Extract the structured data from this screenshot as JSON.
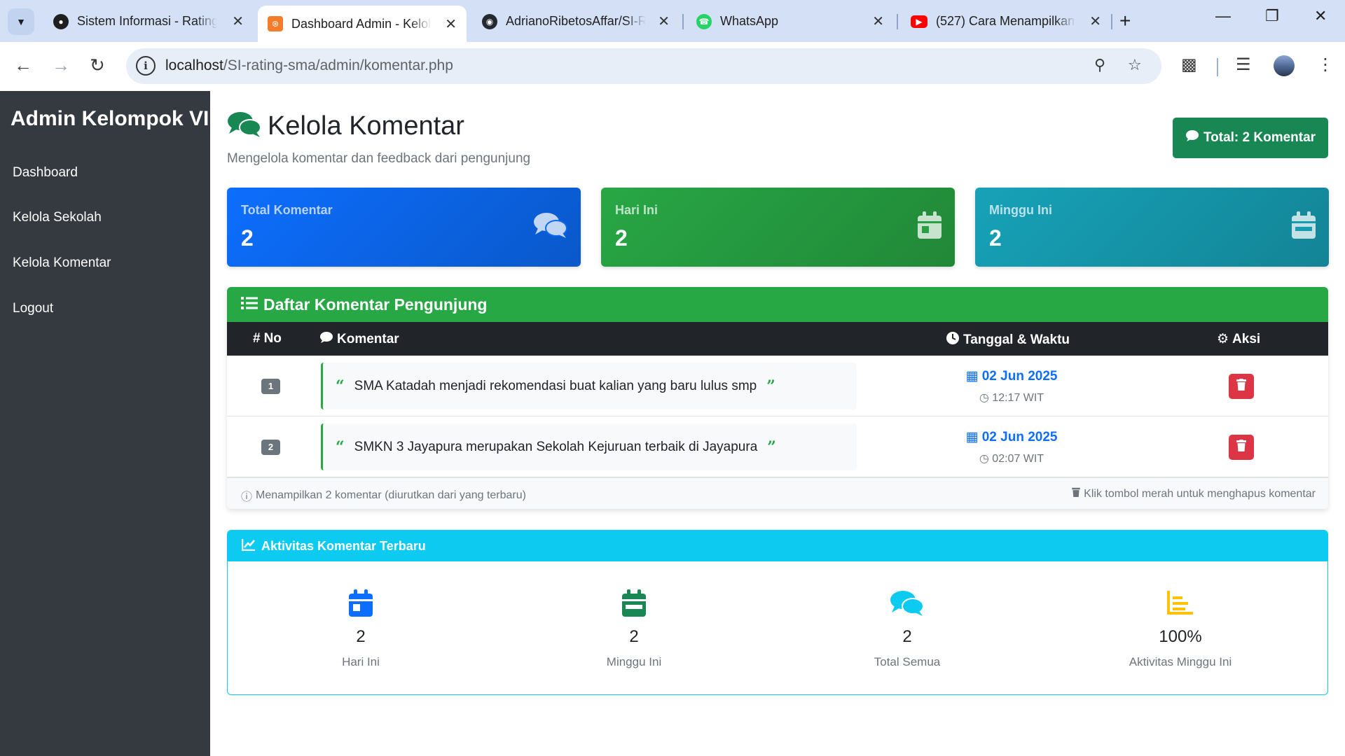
{
  "browser": {
    "tabs": [
      {
        "title": "Sistem Informasi - Rating",
        "favicon": "github-dark-icon",
        "active": false
      },
      {
        "title": "Dashboard Admin - Kelola",
        "favicon": "xampp-icon",
        "active": true
      },
      {
        "title": "AdrianoRibetosAffar/SI-R",
        "favicon": "github-icon",
        "active": false
      },
      {
        "title": "WhatsApp",
        "favicon": "whatsapp-icon",
        "active": false
      },
      {
        "title": "(527) Cara Menampilkan",
        "favicon": "youtube-icon",
        "active": false
      }
    ],
    "url_host": "localhost",
    "url_path": "/SI-rating-sma/admin/komentar.php"
  },
  "sidebar": {
    "brand": "Admin Kelompok VII",
    "items": [
      {
        "label": "Dashboard"
      },
      {
        "label": "Kelola Sekolah"
      },
      {
        "label": "Kelola Komentar"
      },
      {
        "label": "Logout"
      }
    ]
  },
  "header": {
    "title": "Kelola Komentar",
    "subtitle": "Mengelola komentar dan feedback dari pengunjung",
    "total_badge": "Total: 2 Komentar"
  },
  "stats": [
    {
      "label": "Total Komentar",
      "value": "2",
      "color": "#0d6efd",
      "icon": "comments-icon"
    },
    {
      "label": "Hari Ini",
      "value": "2",
      "color": "#28a745",
      "icon": "calendar-day-icon"
    },
    {
      "label": "Minggu Ini",
      "value": "2",
      "color": "#17a2b8",
      "icon": "calendar-week-icon"
    }
  ],
  "comments_panel": {
    "title": "Daftar Komentar Pengunjung",
    "columns": {
      "no": "No",
      "komentar": "Komentar",
      "tanggal": "Tanggal & Waktu",
      "aksi": "Aksi"
    },
    "rows": [
      {
        "no": "1",
        "text": "SMA Katadah menjadi rekomendasi buat kalian yang baru lulus smp",
        "date": "02 Jun 2025",
        "time": "12:17 WIT"
      },
      {
        "no": "2",
        "text": "SMKN 3 Jayapura merupakan Sekolah Kejuruan terbaik di Jayapura",
        "date": "02 Jun 2025",
        "time": "02:07 WIT"
      }
    ],
    "footer_left": "Menampilkan 2 komentar (diurutkan dari yang terbaru)",
    "footer_right": "Klik tombol merah untuk menghapus komentar"
  },
  "activity": {
    "title": "Aktivitas Komentar Terbaru",
    "items": [
      {
        "value": "2",
        "label": "Hari Ini",
        "icon": "calendar-day-icon",
        "color": "#0d6efd"
      },
      {
        "value": "2",
        "label": "Minggu Ini",
        "icon": "calendar-week-icon",
        "color": "#198754"
      },
      {
        "value": "2",
        "label": "Total Semua",
        "icon": "comments-icon",
        "color": "#0dcaf0"
      },
      {
        "value": "100%",
        "label": "Aktivitas Minggu Ini",
        "icon": "chart-line-icon",
        "color": "#ffc107"
      }
    ]
  }
}
